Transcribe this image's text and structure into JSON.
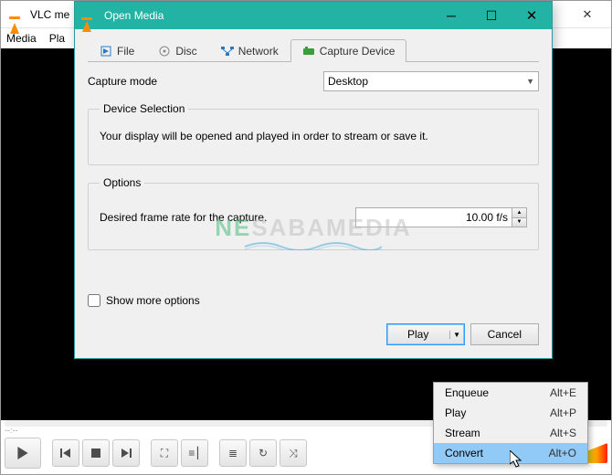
{
  "bg": {
    "title": "VLC me",
    "menu": [
      "Media",
      "Pla"
    ],
    "ticks": "--:--"
  },
  "dialog": {
    "title": "Open Media",
    "tabs": {
      "file": "File",
      "disc": "Disc",
      "network": "Network",
      "capture": "Capture Device"
    },
    "capture_mode_label": "Capture mode",
    "capture_mode_value": "Desktop",
    "device_selection": {
      "legend": "Device Selection",
      "text": "Your display will be opened and played in order to stream or save it."
    },
    "options": {
      "legend": "Options",
      "fps_label": "Desired frame rate for the capture.",
      "fps_value": "10.00 f/s"
    },
    "show_more": "Show more options",
    "footer": {
      "play": "Play",
      "cancel": "Cancel"
    }
  },
  "menu": {
    "items": [
      {
        "label": "Enqueue",
        "shortcut": "Alt+E"
      },
      {
        "label": "Play",
        "shortcut": "Alt+P"
      },
      {
        "label": "Stream",
        "shortcut": "Alt+S"
      },
      {
        "label": "Convert",
        "shortcut": "Alt+O"
      }
    ]
  },
  "watermark": {
    "n": "NE",
    "rest": "SABAMEDIA"
  }
}
